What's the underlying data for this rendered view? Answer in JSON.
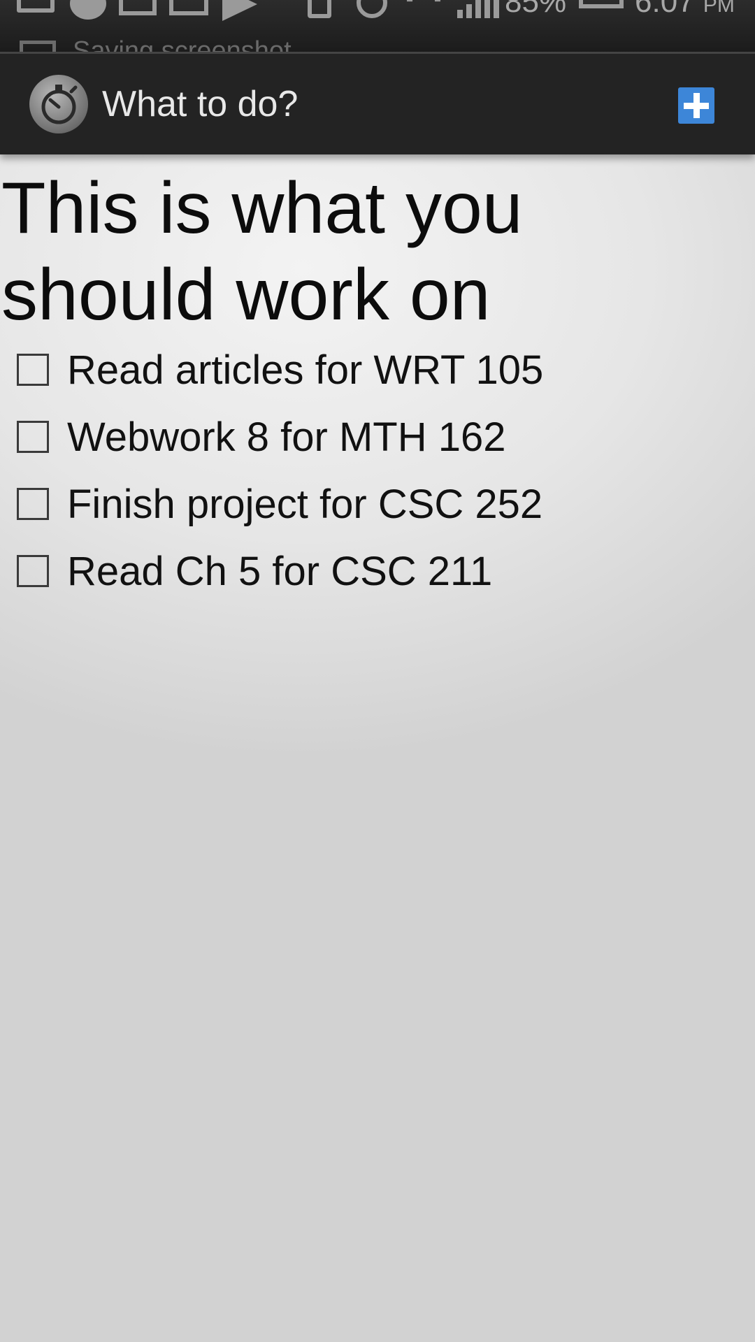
{
  "status_bar": {
    "battery": "85%",
    "time": "6:07",
    "ampm": "PM",
    "notification": "Saving screenshot..."
  },
  "app_bar": {
    "title": "What to do?",
    "add_icon": "plus-icon",
    "logo_icon": "stopwatch-icon",
    "accent_color": "#3d86d8"
  },
  "main": {
    "title": "This is what you should work on",
    "tasks": [
      {
        "label": "Read articles for WRT 105",
        "checked": false
      },
      {
        "label": "Webwork 8 for MTH 162",
        "checked": false
      },
      {
        "label": "Finish project for CSC 252",
        "checked": false
      },
      {
        "label": "Read Ch 5 for CSC 211",
        "checked": false
      }
    ]
  }
}
